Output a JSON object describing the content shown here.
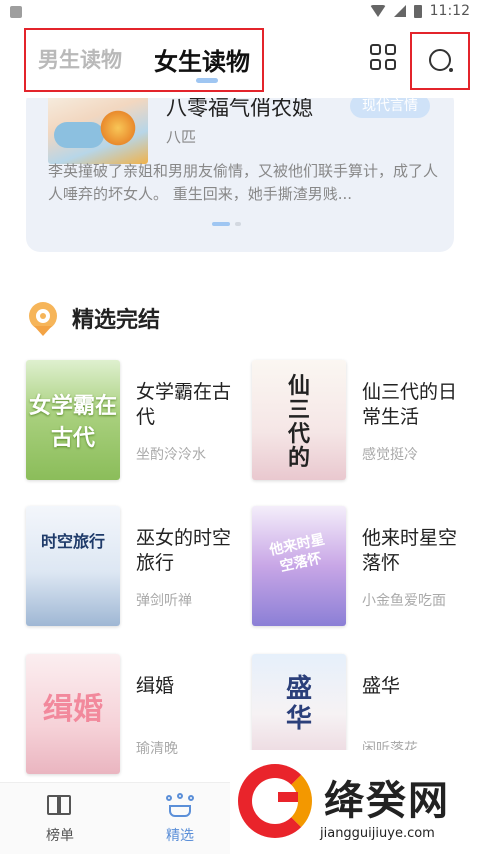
{
  "status_bar": {
    "time": "11:12"
  },
  "header": {
    "tabs": [
      {
        "label": "男生读物",
        "active": false
      },
      {
        "label": "女生读物",
        "active": true
      }
    ],
    "icons": [
      "grid-icon",
      "search-icon"
    ]
  },
  "banner": {
    "title": "八零福气俏农媳",
    "author": "八匹",
    "tag": "现代言情",
    "description": "李英撞破了亲姐和男朋友偷情，又被他们联手算计，成了人人唾弃的坏女人。 重生回来，她手撕渣男贱..."
  },
  "section": {
    "title": "精选完结"
  },
  "books": [
    {
      "title": "女学霸在古代",
      "author": "坐酌泠泠水",
      "cover_text": "女学霸在古代"
    },
    {
      "title": "仙三代的日常生活",
      "author": "感觉挺冷",
      "cover_text": "仙三代的"
    },
    {
      "title": "巫女的时空旅行",
      "author": "弹剑听禅",
      "cover_text": "时空旅行"
    },
    {
      "title": "他来时星空落怀",
      "author": "小金鱼爱吃面",
      "cover_text": "他来时星空落怀"
    },
    {
      "title": "缉婚",
      "author": "瑜清晚",
      "cover_text": "缉婚"
    },
    {
      "title": "盛华",
      "author": "闲听落花",
      "cover_text": "盛华"
    }
  ],
  "bottom_nav": [
    {
      "label": "榜单",
      "icon": "book-icon",
      "active": false,
      "color": "#555555"
    },
    {
      "label": "精选",
      "icon": "crown-icon",
      "active": true,
      "color": "#5b8fd8"
    }
  ],
  "watermark": {
    "name": "绛癸网",
    "url": "jiangguijiuye.com"
  }
}
